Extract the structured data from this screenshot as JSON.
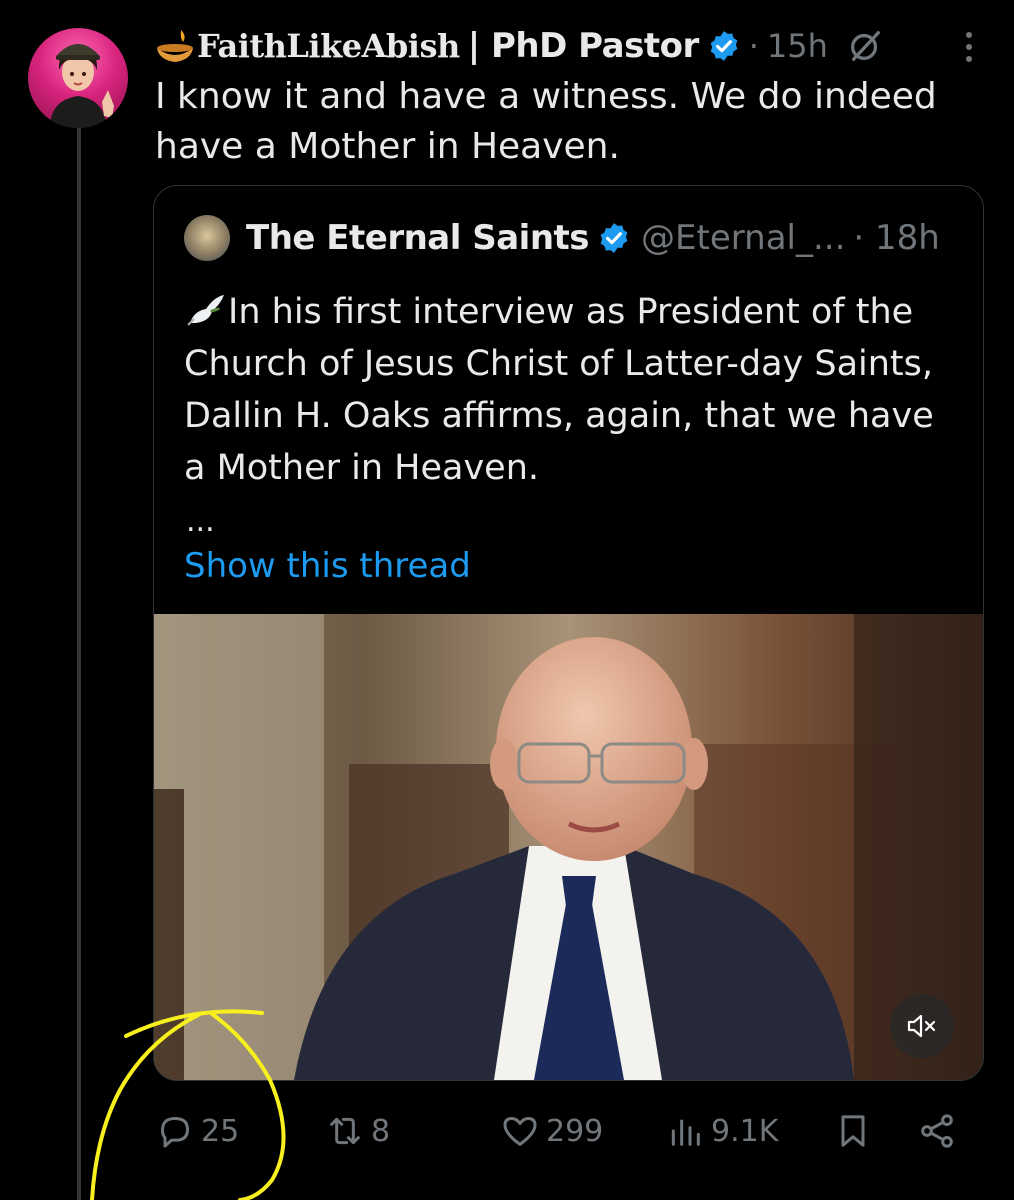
{
  "tweet": {
    "display_name": "FaithLikeAbish",
    "display_name_suffix": "| PhD Pastor",
    "separator": "·",
    "time": "15h",
    "text": "I know it and have a witness. We do indeed have a Mother in Heaven."
  },
  "quoted_tweet": {
    "display_name": "The Eternal Saints",
    "handle": "@Eternal_...",
    "time": "· 18h",
    "text": "In his first interview as President of the Church of Jesus Christ of Latter-day Saints, Dallin H. Oaks affirms, again, that we have a Mother in Heaven.",
    "ellipsis": "...",
    "show_thread": "Show this thread"
  },
  "actions": {
    "replies": "25",
    "reposts": "8",
    "likes": "299",
    "views": "9.1K"
  },
  "icons": {
    "verified": "verified-badge-icon",
    "grok": "grok-icon",
    "more": "more-vertical-icon",
    "mute": "volume-mute-icon",
    "reply": "reply-icon",
    "repost": "repost-icon",
    "like": "heart-icon",
    "views": "analytics-icon",
    "bookmark": "bookmark-icon",
    "share": "share-icon"
  },
  "colors": {
    "background": "#000000",
    "text": "#e7e9ea",
    "muted": "#71767b",
    "link": "#1d9bf0",
    "verified": "#1d9bf0",
    "annotation": "#f7ef1e"
  }
}
